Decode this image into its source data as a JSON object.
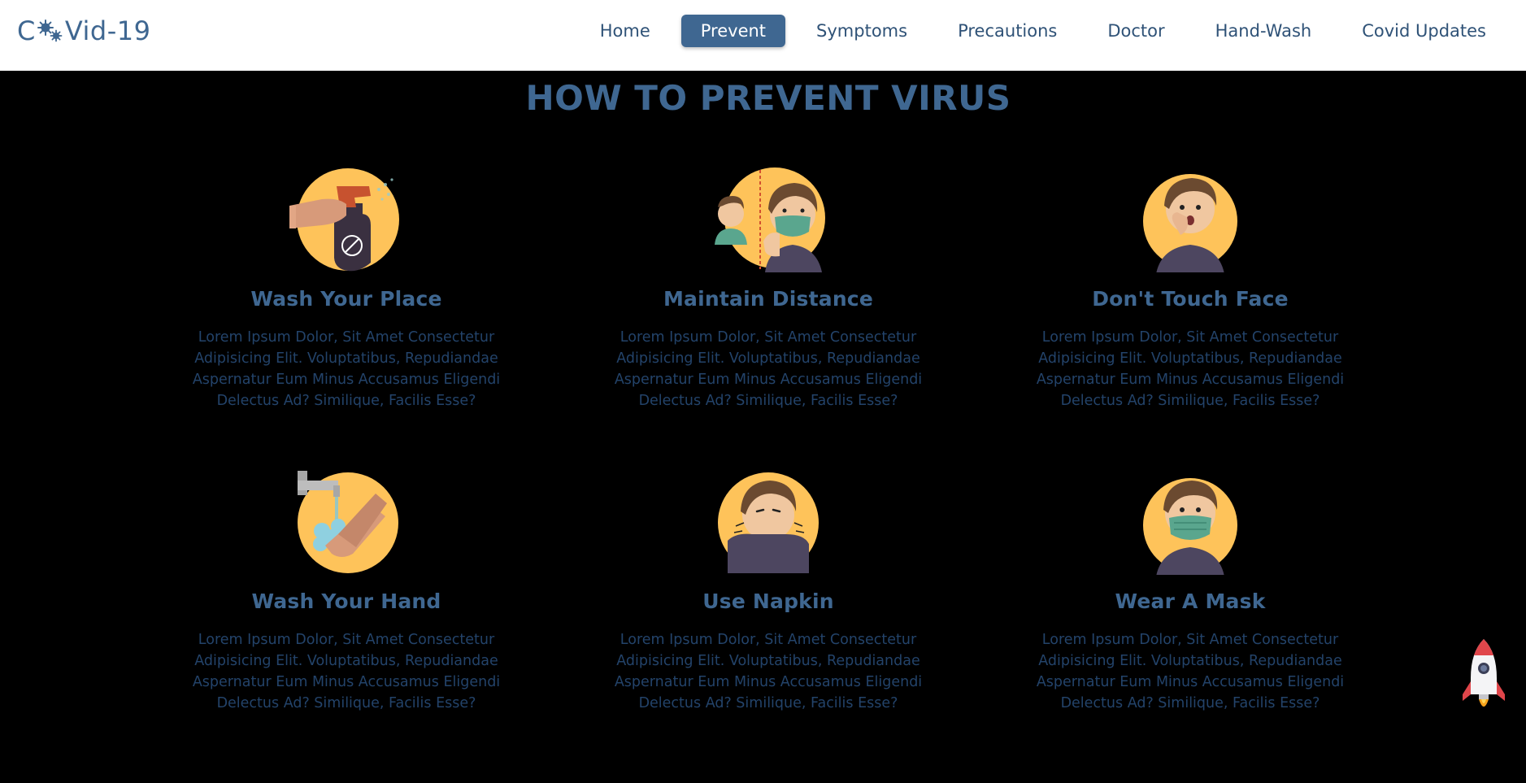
{
  "header": {
    "logo": {
      "prefix": "C",
      "suffix": "Vid-19"
    },
    "nav": [
      {
        "label": "Home",
        "active": false
      },
      {
        "label": "Prevent",
        "active": true
      },
      {
        "label": "Symptoms",
        "active": false
      },
      {
        "label": "Precautions",
        "active": false
      },
      {
        "label": "Doctor",
        "active": false
      },
      {
        "label": "Hand-Wash",
        "active": false
      },
      {
        "label": "Covid Updates",
        "active": false
      }
    ]
  },
  "main": {
    "title": "HOW TO PREVENT VIRUS",
    "cards": [
      {
        "title": "Wash Your Place",
        "text": "Lorem Ipsum Dolor, Sit Amet Consectetur Adipisicing Elit. Voluptatibus, Repudiandae Aspernatur Eum Minus Accusamus Eligendi Delectus Ad? Similique, Facilis Esse?",
        "icon": "spray-bottle-icon"
      },
      {
        "title": "Maintain Distance",
        "text": "Lorem Ipsum Dolor, Sit Amet Consectetur Adipisicing Elit. Voluptatibus, Repudiandae Aspernatur Eum Minus Accusamus Eligendi Delectus Ad? Similique, Facilis Esse?",
        "icon": "distance-icon"
      },
      {
        "title": "Don't Touch Face",
        "text": "Lorem Ipsum Dolor, Sit Amet Consectetur Adipisicing Elit. Voluptatibus, Repudiandae Aspernatur Eum Minus Accusamus Eligendi Delectus Ad? Similique, Facilis Esse?",
        "icon": "touch-face-icon"
      },
      {
        "title": "Wash Your Hand",
        "text": "Lorem Ipsum Dolor, Sit Amet Consectetur Adipisicing Elit. Voluptatibus, Repudiandae Aspernatur Eum Minus Accusamus Eligendi Delectus Ad? Similique, Facilis Esse?",
        "icon": "hand-wash-icon"
      },
      {
        "title": "Use Napkin",
        "text": "Lorem Ipsum Dolor, Sit Amet Consectetur Adipisicing Elit. Voluptatibus, Repudiandae Aspernatur Eum Minus Accusamus Eligendi Delectus Ad? Similique, Facilis Esse?",
        "icon": "napkin-icon"
      },
      {
        "title": "Wear A Mask",
        "text": "Lorem Ipsum Dolor, Sit Amet Consectetur Adipisicing Elit. Voluptatibus, Repudiandae Aspernatur Eum Minus Accusamus Eligendi Delectus Ad? Similique, Facilis Esse?",
        "icon": "mask-icon"
      }
    ]
  },
  "scroll_top": {
    "icon": "rocket-icon"
  },
  "colors": {
    "accent": "#3f6791",
    "text_dim": "#23436a",
    "circle": "#fec35a",
    "background": "#000000"
  }
}
